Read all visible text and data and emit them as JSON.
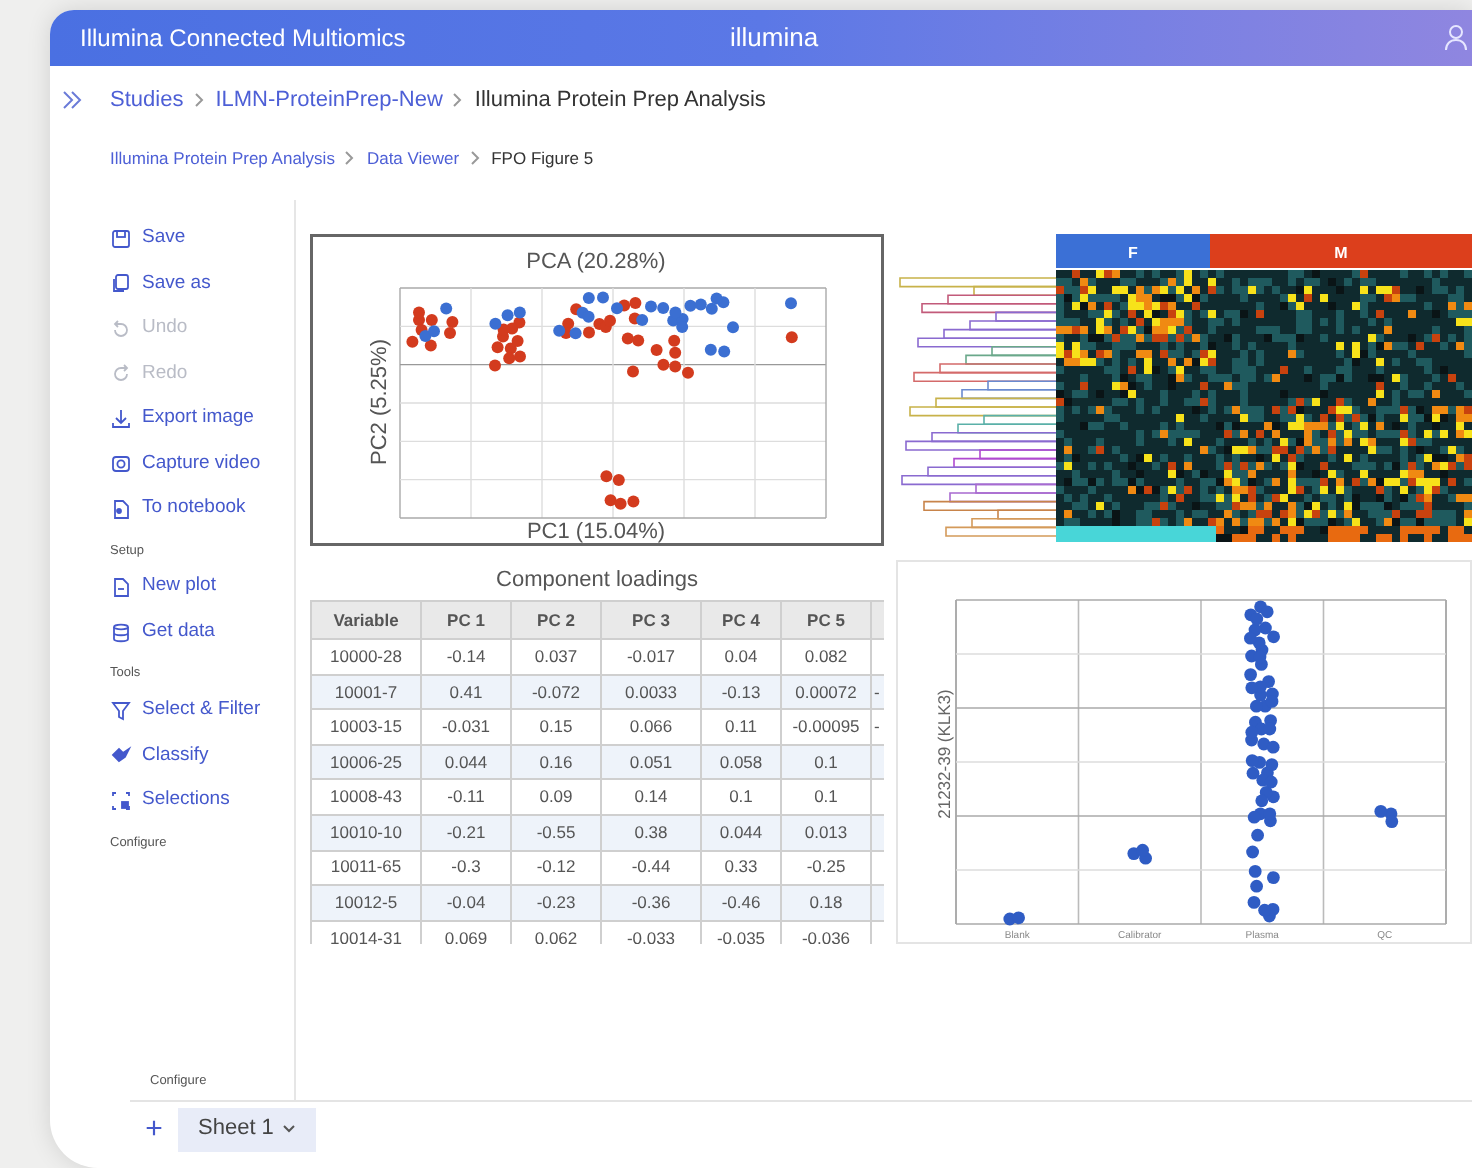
{
  "header": {
    "product": "Illumina Connected Multiomics",
    "logo": "illumina"
  },
  "breadcrumbs": [
    {
      "label": "Studies",
      "link": true
    },
    {
      "label": "ILMN-ProteinPrep-New",
      "link": true
    },
    {
      "label": "Illumina Protein Prep Analysis",
      "link": false
    }
  ],
  "sub_breadcrumbs": [
    {
      "label": "Illumina Protein Prep Analysis",
      "link": true
    },
    {
      "label": "Data Viewer",
      "link": true
    },
    {
      "label": "FPO Figure 5",
      "link": false
    }
  ],
  "sidebar": [
    {
      "items": [
        {
          "label": "Save",
          "disabled": false
        },
        {
          "label": "Save as",
          "disabled": false
        },
        {
          "label": "Undo",
          "disabled": true
        },
        {
          "label": "Redo",
          "disabled": true
        },
        {
          "label": "Export image",
          "disabled": false
        },
        {
          "label": "Capture video",
          "disabled": false
        },
        {
          "label": "To notebook",
          "disabled": false
        }
      ]
    },
    {
      "heading": "Setup",
      "items": [
        {
          "label": "New plot",
          "disabled": false
        },
        {
          "label": "Get data",
          "disabled": false
        }
      ]
    },
    {
      "heading": "Tools",
      "items": [
        {
          "label": "Select & Filter",
          "disabled": false
        },
        {
          "label": "Classify",
          "disabled": false
        },
        {
          "label": "Selections",
          "disabled": false
        }
      ]
    },
    {
      "heading": "Configure"
    }
  ],
  "pca": {
    "title": "PCA (20.28%)",
    "xlabel": "PC1 (15.04%)",
    "ylabel": "PC2 (5.25%)"
  },
  "heatmap": {
    "groups": [
      {
        "label": "F",
        "color": "#3b70d6"
      },
      {
        "label": "M",
        "color": "#dc3f1c"
      }
    ]
  },
  "loadings": {
    "title": "Component loadings",
    "columns": [
      "Variable",
      "PC 1",
      "PC 2",
      "PC 3",
      "PC 4",
      "PC 5"
    ],
    "rows": [
      {
        "cells": [
          "10000-28",
          "-0.14",
          "0.037",
          "-0.017",
          "0.04",
          "0.082"
        ]
      },
      {
        "cells": [
          "10001-7",
          "0.41",
          "-0.072",
          "0.0033",
          "-0.13",
          "0.00072"
        ],
        "overflow": "-"
      },
      {
        "cells": [
          "10003-15",
          "-0.031",
          "0.15",
          "0.066",
          "0.11",
          "-0.00095"
        ],
        "overflow": "-"
      },
      {
        "cells": [
          "10006-25",
          "0.044",
          "0.16",
          "0.051",
          "0.058",
          "0.1"
        ]
      },
      {
        "cells": [
          "10008-43",
          "-0.11",
          "0.09",
          "0.14",
          "0.1",
          "0.1"
        ]
      },
      {
        "cells": [
          "10010-10",
          "-0.21",
          "-0.55",
          "0.38",
          "0.044",
          "0.013"
        ]
      },
      {
        "cells": [
          "10011-65",
          "-0.3",
          "-0.12",
          "-0.44",
          "0.33",
          "-0.25"
        ]
      },
      {
        "cells": [
          "10012-5",
          "-0.04",
          "-0.23",
          "-0.36",
          "-0.46",
          "0.18"
        ]
      },
      {
        "cells": [
          "10014-31",
          "0.069",
          "0.062",
          "-0.033",
          "-0.035",
          "-0.036"
        ]
      }
    ]
  },
  "strip_plot": {
    "ylabel": "21232-39 (KLK3)",
    "categories": [
      "Blank",
      "Calibrator",
      "Plasma",
      "QC"
    ]
  },
  "footer": {
    "configure": "Configure",
    "add": "+",
    "sheets": [
      {
        "label": "Sheet 1",
        "selected": true
      }
    ]
  }
}
